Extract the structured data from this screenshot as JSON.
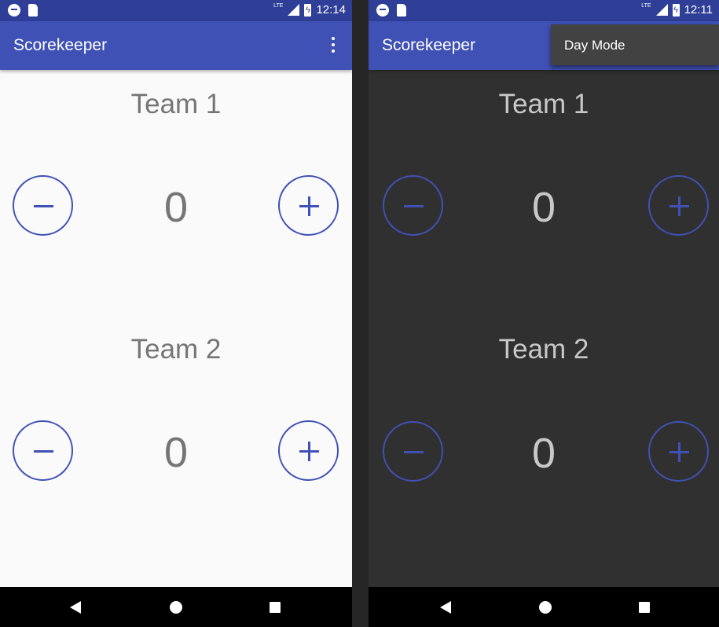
{
  "colors": {
    "primary": "#3f51b5",
    "primary_dark": "#2f3e96",
    "day_background": "#fafafa",
    "night_background": "#303030",
    "day_text": "#757575",
    "night_text": "#c8c8c8"
  },
  "screens": [
    {
      "mode": "day",
      "status_bar": {
        "network": "LTE",
        "time": "12:14"
      },
      "app_bar": {
        "title": "Scorekeeper",
        "overflow_icon": "more-vert-icon"
      },
      "teams": [
        {
          "name": "Team 1",
          "score": "0",
          "decrement_icon": "minus-icon",
          "increment_icon": "plus-icon"
        },
        {
          "name": "Team 2",
          "score": "0",
          "decrement_icon": "minus-icon",
          "increment_icon": "plus-icon"
        }
      ]
    },
    {
      "mode": "night",
      "status_bar": {
        "network": "LTE",
        "time": "12:11"
      },
      "app_bar": {
        "title": "Scorekeeper"
      },
      "overflow_menu": {
        "items": [
          {
            "label": "Day Mode"
          }
        ]
      },
      "teams": [
        {
          "name": "Team 1",
          "score": "0",
          "decrement_icon": "minus-icon",
          "increment_icon": "plus-icon"
        },
        {
          "name": "Team 2",
          "score": "0",
          "decrement_icon": "minus-icon",
          "increment_icon": "plus-icon"
        }
      ]
    }
  ],
  "nav_bar": {
    "icons": [
      "back-icon",
      "home-icon",
      "recents-icon"
    ]
  }
}
